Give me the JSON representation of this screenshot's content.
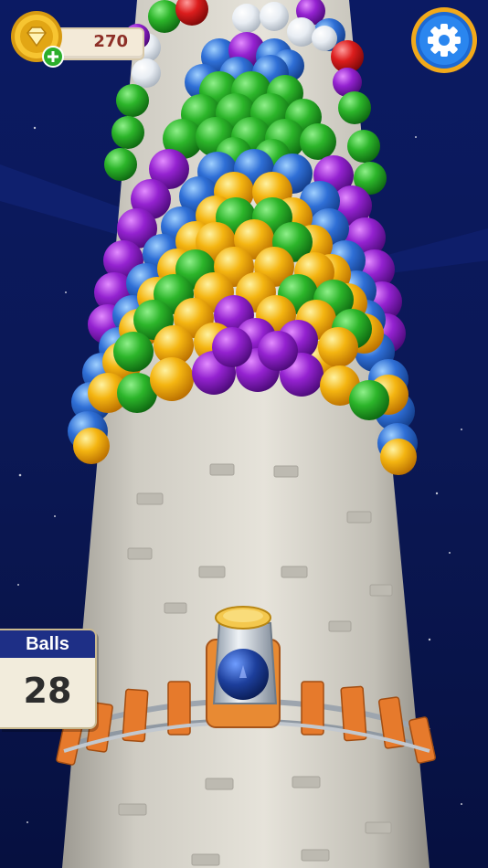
{
  "hud": {
    "gems_value": "270",
    "gems_icon": "diamond-coin-icon",
    "add_icon": "plus-icon",
    "settings_icon": "gear-icon"
  },
  "balls_panel": {
    "label": "Balls",
    "count": "28"
  },
  "colors": {
    "sky": "#0a1a5a",
    "tower": "#d6d3c9",
    "rail": "#e07a2e",
    "header_blue": "#1e2f86",
    "ball_green": "#2cb52a",
    "ball_purple": "#8a1fc9",
    "ball_blue": "#2f6fd6",
    "ball_yellow": "#f2b50f",
    "ball_red": "#d81c1c"
  }
}
